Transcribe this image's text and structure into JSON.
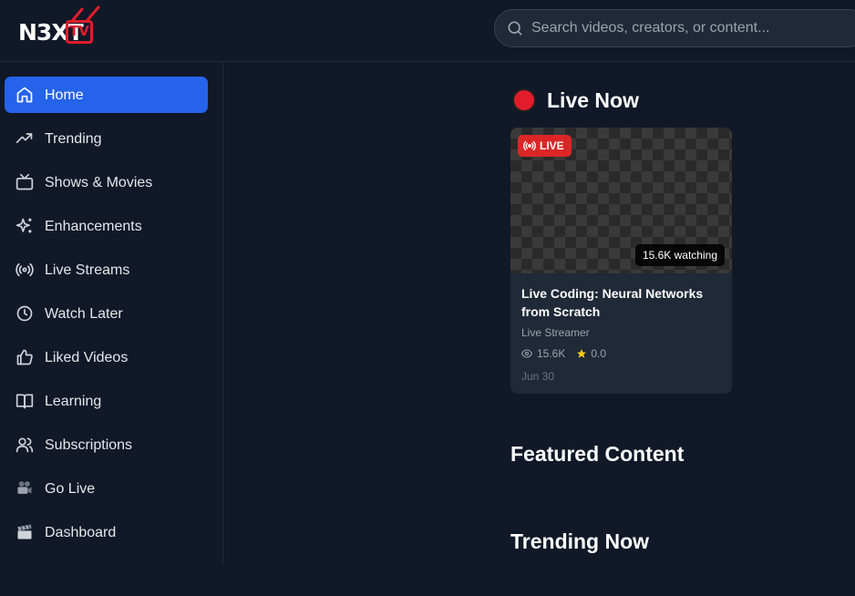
{
  "header": {
    "logo": {
      "text": "N3XT",
      "tv": "TV"
    },
    "search": {
      "placeholder": "Search videos, creators, or content..."
    }
  },
  "sidebar": {
    "items": [
      {
        "label": "Home",
        "icon": "home-icon",
        "active": true
      },
      {
        "label": "Trending",
        "icon": "trending-icon"
      },
      {
        "label": "Shows & Movies",
        "icon": "tv-icon"
      },
      {
        "label": "Enhancements",
        "icon": "sparkles-icon"
      },
      {
        "label": "Live Streams",
        "icon": "broadcast-icon"
      },
      {
        "label": "Watch Later",
        "icon": "clock-icon"
      },
      {
        "label": "Liked Videos",
        "icon": "thumbs-up-icon"
      },
      {
        "label": "Learning",
        "icon": "book-icon"
      },
      {
        "label": "Subscriptions",
        "icon": "users-icon"
      },
      {
        "label": "Go Live",
        "icon": "camera-icon"
      },
      {
        "label": "Dashboard",
        "icon": "clapper-icon"
      }
    ]
  },
  "main": {
    "live_now": {
      "title": "Live Now",
      "card": {
        "badge": "LIVE",
        "watching": "15.6K watching",
        "title": "Live Coding: Neural Networks from Scratch",
        "creator": "Live Streamer",
        "views": "15.6K",
        "rating": "0.0",
        "date": "Jun 30"
      }
    },
    "featured_title": "Featured Content",
    "trending_title": "Trending Now"
  },
  "colors": {
    "background": "#111827",
    "accent": "#2563eb",
    "live": "#dc2626",
    "card": "#1f2937",
    "star": "#facc15"
  }
}
